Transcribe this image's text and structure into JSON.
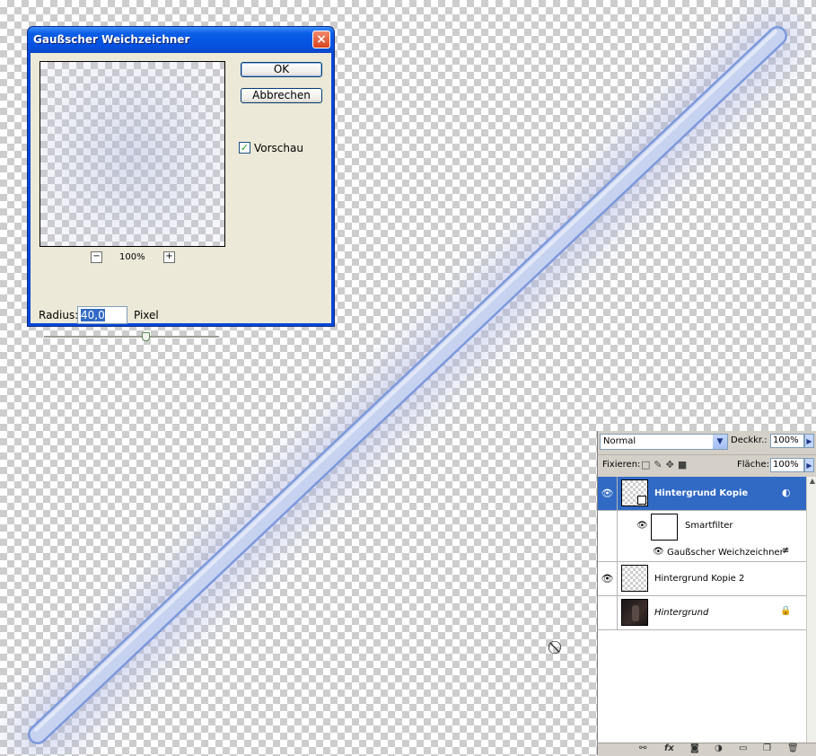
{
  "dialog": {
    "title": "Gaußscher Weichzeichner",
    "close_glyph": "×",
    "ok_label": "OK",
    "cancel_label": "Abbrechen",
    "preview_checkbox_label": "Vorschau",
    "preview_checked": true,
    "zoom_out_glyph": "−",
    "zoom_in_glyph": "+",
    "zoom_level": "100%",
    "radius_label": "Radius:",
    "radius_value": "40,0",
    "radius_unit": "Pixel",
    "slider_fraction": 0.58
  },
  "layers_panel": {
    "blend_mode": "Normal",
    "opacity_label": "Deckkr.:",
    "opacity_value": "100%",
    "lock_label": "Fixieren:",
    "fill_label": "Fläche:",
    "fill_value": "100%",
    "layers": [
      {
        "name": "Hintergrund Kopie",
        "visible": true,
        "selected": true,
        "bold": true
      },
      {
        "name": "Smartfilter",
        "visible": true,
        "sublevel": 1
      },
      {
        "name": "Gaußscher Weichzeichner",
        "visible": true,
        "sublevel": 2
      },
      {
        "name": "Hintergrund Kopie 2",
        "visible": true
      },
      {
        "name": "Hintergrund",
        "visible": false,
        "italic": true,
        "locked": true
      }
    ]
  },
  "colors": {
    "saber_core": "#dfe7f6",
    "saber_edge": "#6f8fd8",
    "glow": "#9ba9dd",
    "xp_title": "#0a5ee6",
    "selection": "#316ac5"
  }
}
